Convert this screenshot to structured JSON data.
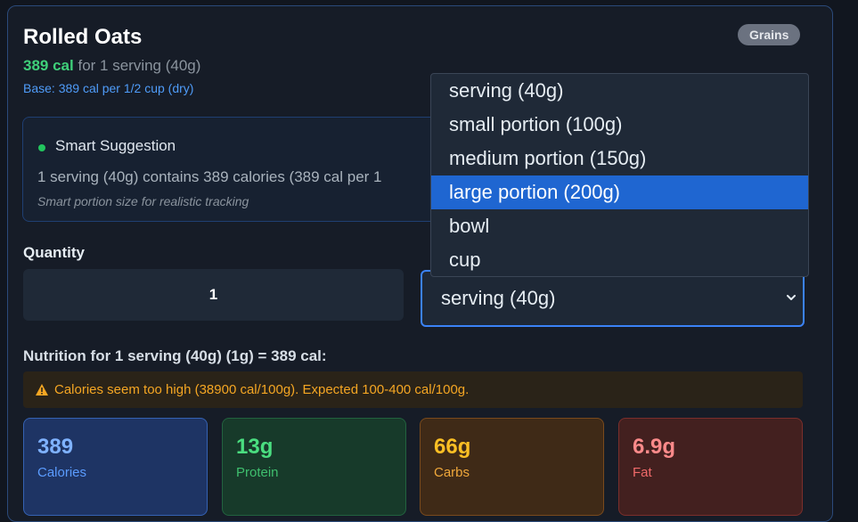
{
  "food": {
    "name": "Rolled Oats",
    "category": "Grains",
    "calories_label": "389 cal",
    "serving_text": "for 1 serving (40g)",
    "base_text": "Base: 389 cal per 1/2 cup (dry)"
  },
  "suggestion": {
    "heading": "Smart Suggestion",
    "body": "1 serving (40g) contains 389 calories (389 cal per 1",
    "note": "Smart portion size for realistic tracking"
  },
  "quantity": {
    "label": "Quantity",
    "value": "1"
  },
  "unit": {
    "selected": "serving (40g)",
    "options": [
      "serving (40g)",
      "small portion (100g)",
      "medium portion (150g)",
      "large portion (200g)",
      "bowl",
      "cup"
    ],
    "highlighted_index": 3
  },
  "nutrition": {
    "heading": "Nutrition for 1 serving (40g) (1g) = 389 cal:",
    "warning": "Calories seem too high (38900 cal/100g). Expected 100-400 cal/100g.",
    "tiles": [
      {
        "value": "389",
        "label": "Calories"
      },
      {
        "value": "13g",
        "label": "Protein"
      },
      {
        "value": "66g",
        "label": "Carbs"
      },
      {
        "value": "6.9g",
        "label": "Fat"
      }
    ]
  },
  "colors": {
    "accent": "#3b82f6",
    "calories_green": "#3fd07a",
    "warning": "#f5a623",
    "selected_option": "#1f66d1"
  }
}
